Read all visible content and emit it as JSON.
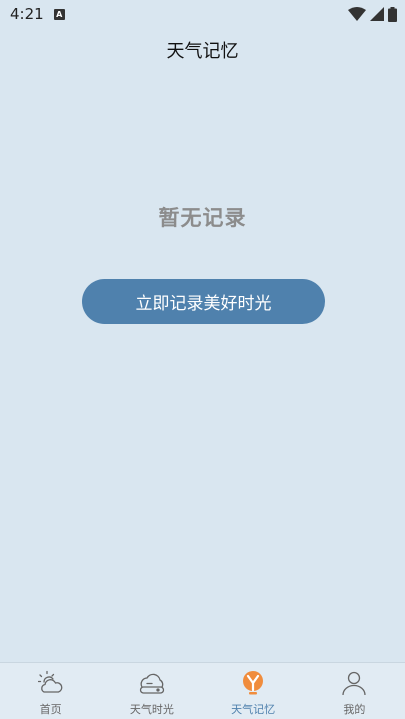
{
  "status_bar": {
    "time": "4:21",
    "notification_icon": "A"
  },
  "header": {
    "title": "天气记忆"
  },
  "main": {
    "empty_text": "暂无记录",
    "record_button_label": "立即记录美好时光"
  },
  "bottom_nav": {
    "active_index": 2,
    "active_color": "#4f81ad",
    "active_icon_color": "#f08c3c",
    "items": [
      {
        "label": "首页",
        "icon": "sun-cloud-icon"
      },
      {
        "label": "天气时光",
        "icon": "weather-time-icon"
      },
      {
        "label": "天气记忆",
        "icon": "weather-memory-icon"
      },
      {
        "label": "我的",
        "icon": "person-icon"
      }
    ]
  }
}
